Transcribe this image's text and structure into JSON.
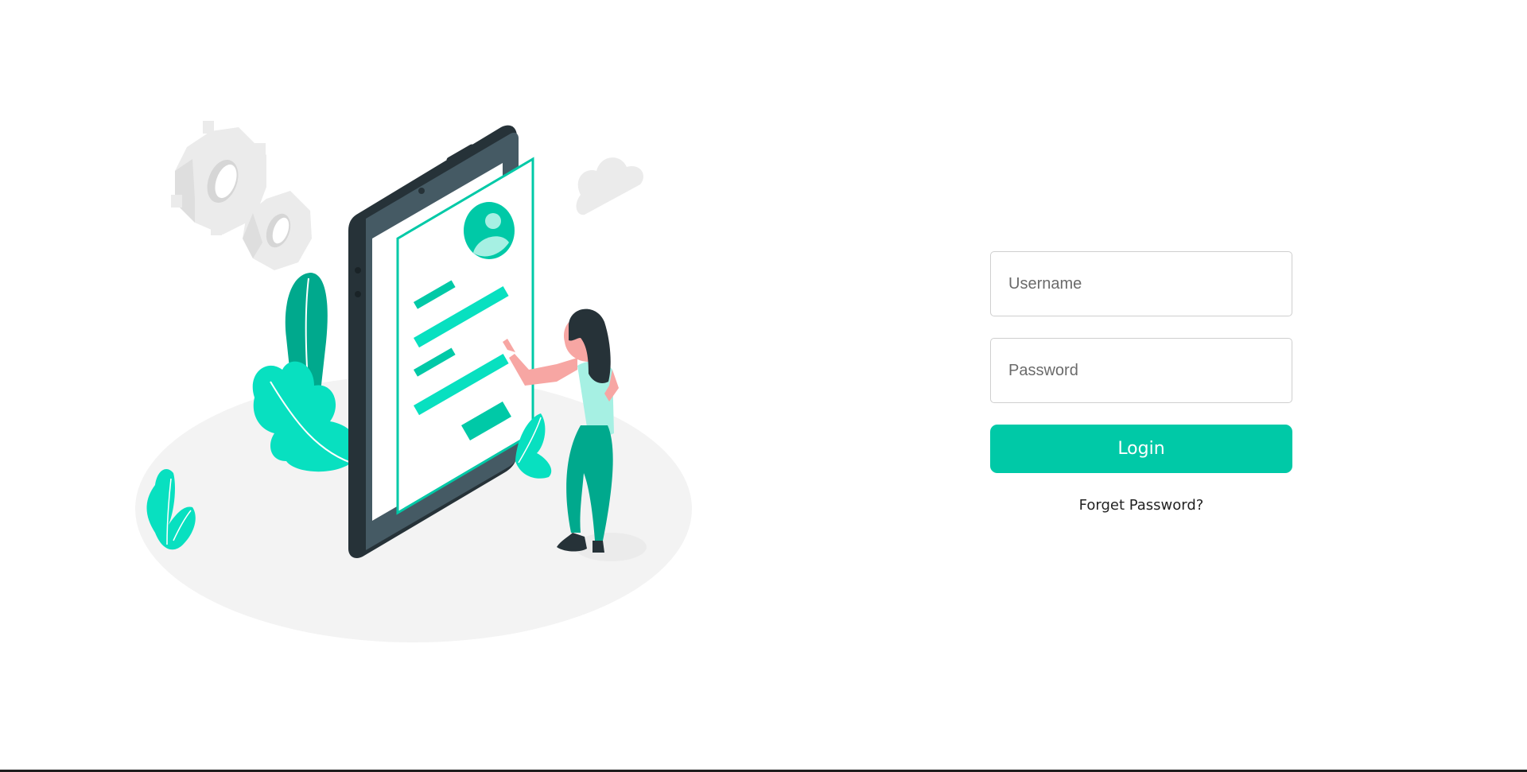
{
  "colors": {
    "accent": "#00c9a7",
    "accent_bright": "#08e0c0",
    "accent_dark": "#00a98d",
    "phone_body": "#263238",
    "phone_side": "#455a64",
    "skin": "#f7a6a3",
    "floor": "#f3f3f3",
    "gear": "#ebebeb"
  },
  "illustration": {
    "icons": [
      "gear-icon",
      "cloud-icon",
      "phone-icon",
      "user-avatar-icon",
      "plant-icon",
      "person-figure"
    ]
  },
  "login": {
    "username_placeholder": "Username",
    "password_placeholder": "Password",
    "login_label": "Login",
    "forgot_label": "Forget Password?"
  }
}
